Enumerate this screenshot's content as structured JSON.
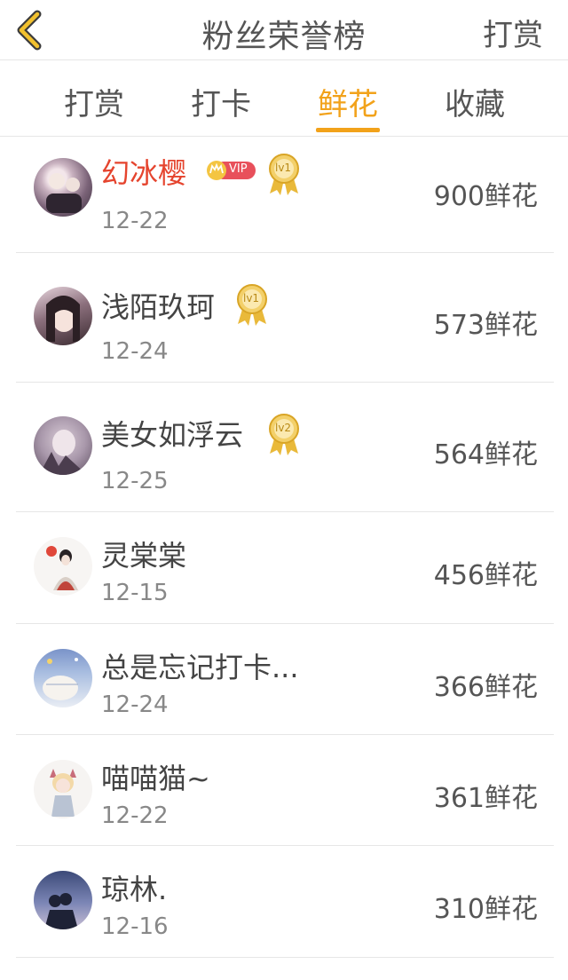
{
  "header": {
    "title": "粉丝荣誉榜",
    "right_label": "打赏"
  },
  "tabs": [
    {
      "label": "打赏"
    },
    {
      "label": "打卡"
    },
    {
      "label": "鲜花"
    },
    {
      "label": "收藏"
    }
  ],
  "active_tab": "鲜花",
  "rows": [
    {
      "name": "幻冰樱",
      "date": "12-22",
      "amount": "900鲜花",
      "vip": "VIP",
      "level": "lv1"
    },
    {
      "name": "浅陌玖珂",
      "date": "12-24",
      "amount": "573鲜花",
      "level": "lv1"
    },
    {
      "name": "美女如浮云",
      "date": "12-25",
      "amount": "564鲜花",
      "level": "lv2"
    },
    {
      "name": "灵棠棠",
      "date": "12-15",
      "amount": "456鲜花"
    },
    {
      "name": "总是忘记打卡...",
      "date": "12-24",
      "amount": "366鲜花"
    },
    {
      "name": "喵喵猫~",
      "date": "12-22",
      "amount": "361鲜花"
    },
    {
      "name": "琼林.",
      "date": "12-16",
      "amount": "310鲜花"
    }
  ],
  "colors": {
    "accent": "#f2a21a",
    "vip_name": "#e5442e",
    "vip_badge": "#e8505b",
    "medal_gold": "#e9b93a"
  },
  "icons": {
    "back": "chevron-left-icon",
    "vip": "crown-vip-icon",
    "level": "medal-ribbon-icon"
  }
}
